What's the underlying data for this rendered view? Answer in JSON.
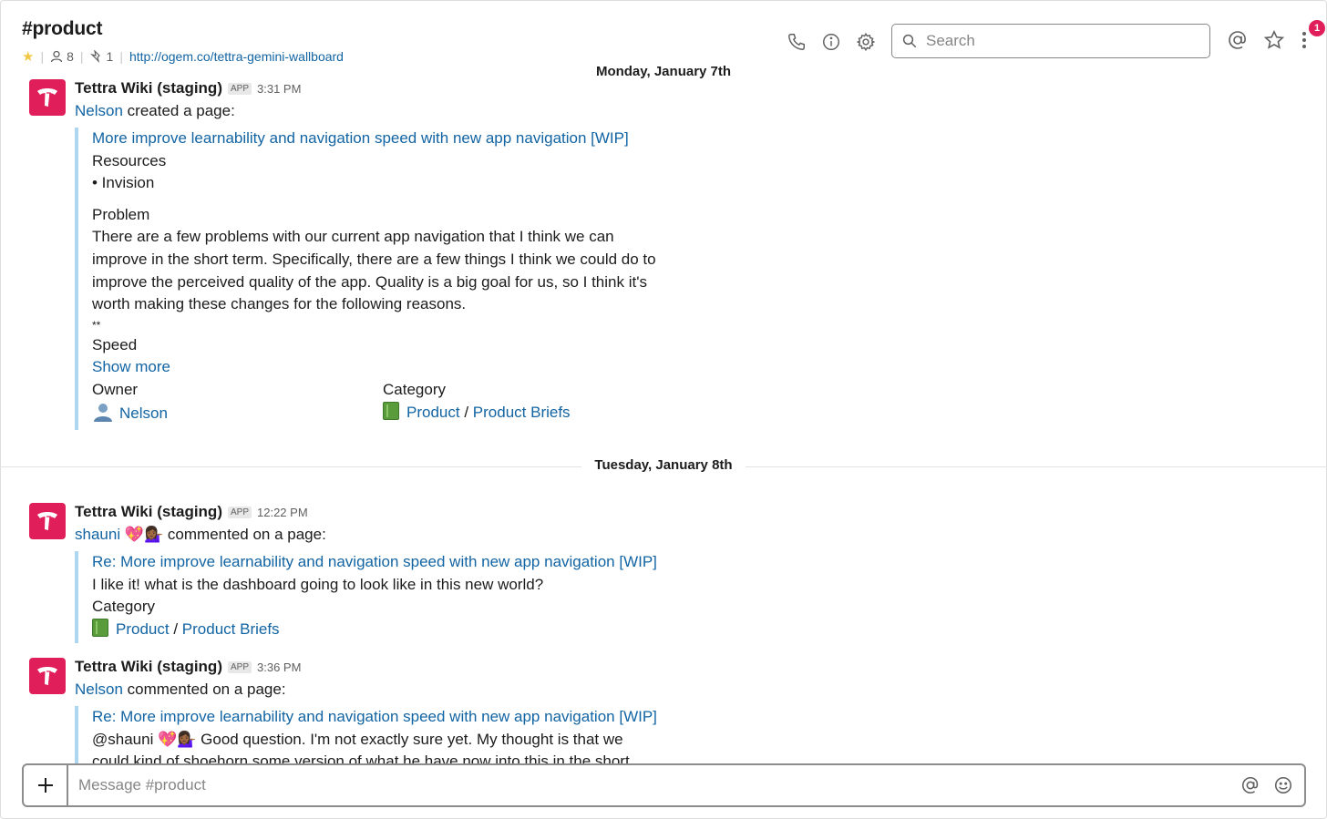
{
  "header": {
    "channel": "#product",
    "members": "8",
    "pins": "1",
    "url": "http://ogem.co/tettra-gemini-wallboard",
    "search_placeholder": "Search",
    "notification_count": "1"
  },
  "days": [
    {
      "label": "Monday, January 7th"
    },
    {
      "label": "Tuesday, January 8th"
    }
  ],
  "messages": [
    {
      "sender": "Tettra Wiki (staging)",
      "tag": "APP",
      "time": "3:31 PM",
      "actor": "Nelson",
      "action": "created a page:",
      "title": "More improve learnability and navigation speed with new app navigation [WIP]",
      "resources_heading": "Resources",
      "resources_item": "• Invision",
      "problem_heading": "Problem",
      "problem_lines": [
        "There are a few problems with our current app navigation that I think we can",
        "improve in the short term. Specifically, there are a few things I think we could do to",
        "improve the perceived quality of the app. Quality is a big goal for us, so I think it's",
        "worth making these changes for the following reasons."
      ],
      "stars": "**",
      "speed_heading": "Speed",
      "show_more": "Show more",
      "owner_label": "Owner",
      "owner_value": "Nelson",
      "category_label": "Category",
      "category_1": "Product",
      "category_sep": "/",
      "category_2": "Product Briefs"
    },
    {
      "sender": "Tettra Wiki (staging)",
      "tag": "APP",
      "time": "12:22 PM",
      "actor": "shauni",
      "actor_emoji": "💖💁🏾‍♀️",
      "action": "commented on a page:",
      "title": "Re: More improve learnability and navigation speed with new app navigation [WIP]",
      "body": "I like it! what is the dashboard going to look like in this new world?",
      "category_label": "Category",
      "category_1": "Product",
      "category_sep": "/",
      "category_2": "Product Briefs"
    },
    {
      "sender": "Tettra Wiki (staging)",
      "tag": "APP",
      "time": "3:36 PM",
      "actor": "Nelson",
      "action": "commented on a page:",
      "title": "Re: More improve learnability and navigation speed with new app navigation [WIP]",
      "body_prefix": "@shauni",
      "body_emoji": "💖💁🏾‍♀️",
      "body_text": "Good question. I'm not exactly sure yet. My thought is that we",
      "body_cut": "could kind of shoehorn some version of what he have now into this in the short"
    }
  ],
  "composer": {
    "placeholder": "Message #product"
  },
  "colors": {
    "link": "#1264a3",
    "avatar": "#e01e5a",
    "attachment_bar": "#aed6f0",
    "badge": "#e01e5a"
  }
}
